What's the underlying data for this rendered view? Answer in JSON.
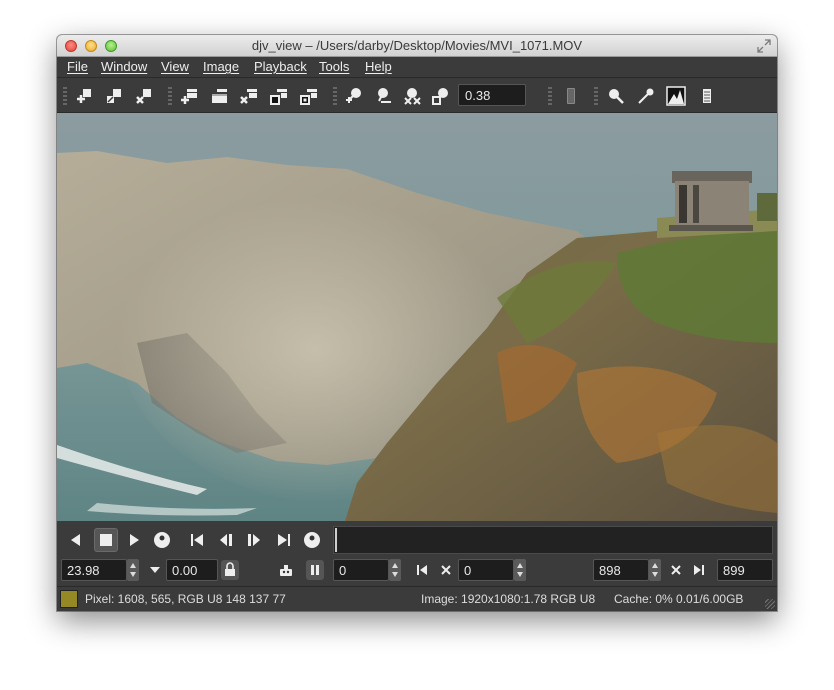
{
  "window": {
    "title": "djv_view – /Users/darby/Desktop/Movies/MVI_1071.MOV"
  },
  "menu": [
    "File",
    "Window",
    "View",
    "Image",
    "Playback",
    "Tools",
    "Help"
  ],
  "toolbar": {
    "icons": [
      "window-new-icon",
      "window-copy-icon",
      "window-close-icon",
      "file-open-icon",
      "file-reload-icon",
      "file-close-icon",
      "file-save-icon",
      "file-save-frame-icon",
      "zoom-in-icon",
      "zoom-out-icon",
      "zoom-reset-icon",
      "zoom-fit-icon",
      "display-profile-icon",
      "magnify-icon",
      "color-picker-icon",
      "histogram-icon",
      "info-icon"
    ],
    "zoom_value": "0.38"
  },
  "playback": {
    "speed": "23.98",
    "real_speed": "0.00",
    "current_frame": "0",
    "in_point": "0",
    "end_frame": "898",
    "out_point": "899"
  },
  "status": {
    "pixel_color": "#948925",
    "pixel": "Pixel: 1608, 565, RGB U8 148 137 77",
    "image": "Image: 1920x1080:1.78 RGB U8",
    "cache": "Cache: 0% 0.01/6.00GB"
  }
}
